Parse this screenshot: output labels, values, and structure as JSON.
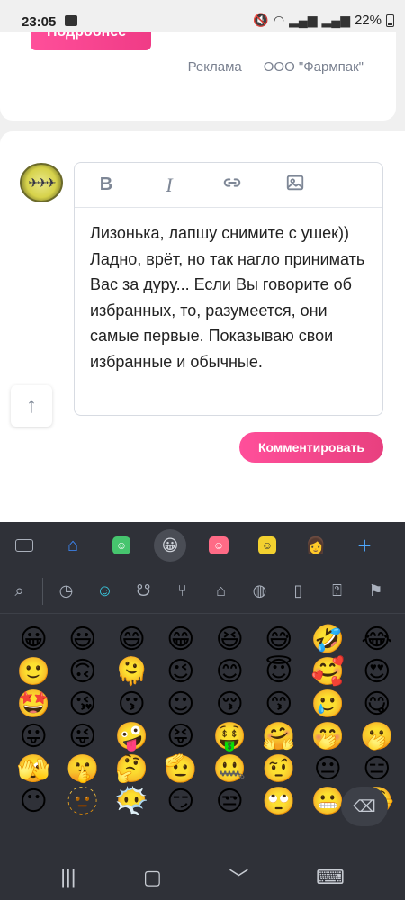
{
  "status_bar": {
    "time": "23:05",
    "battery": "22%"
  },
  "top_card": {
    "button_label": "Подробнее",
    "ad_label": "Реклама",
    "advertiser": "ООО \"Фармпак\""
  },
  "editor": {
    "toolbar": {
      "bold": "B",
      "italic": "I"
    },
    "text": "Лизонька, лапшу снимите с ушек))\nЛадно, врёт, но так нагло принимать Вас за дуру... Если Вы говорите об избранных, то, разумеется, они самые первые. Показываю свои избранные и обычные."
  },
  "submit_label": "Комментировать",
  "keyboard": {
    "emojis": [
      "😀",
      "😃",
      "😄",
      "😁",
      "😆",
      "😅",
      "🤣",
      "😂",
      "🙂",
      "🙃",
      "🫠",
      "😉",
      "😊",
      "😇",
      "🥰",
      "😍",
      "🤩",
      "😘",
      "😗",
      "☺",
      "😚",
      "😙",
      "🥲",
      "😋",
      "😛",
      "😜",
      "🤪",
      "😝",
      "🤑",
      "🤗",
      "🤭",
      "🫢",
      "🫣",
      "🤫",
      "🤔",
      "🫡",
      "🤐",
      "🤨",
      "😐",
      "😑",
      "😶",
      "🫥",
      "😶‍🌫️",
      "😏",
      "😒",
      "🙄",
      "😬",
      "🤥"
    ]
  }
}
